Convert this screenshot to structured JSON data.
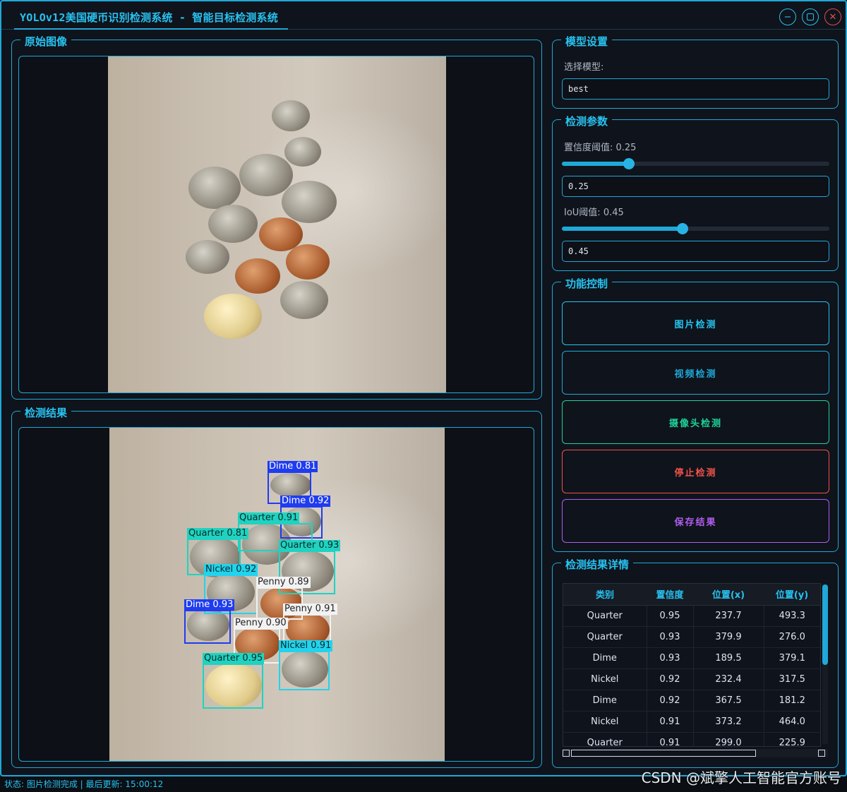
{
  "window": {
    "title": "YOLOv12美国硬币识别检测系统 - 智能目标检测系统",
    "min_glyph": "−",
    "max_glyph": "▢",
    "close_glyph": "✕"
  },
  "original_panel": {
    "title": "原始图像"
  },
  "result_panel": {
    "title": "检测结果",
    "detections": [
      {
        "label": "Dime 0.81",
        "color": "#1f3cf0",
        "text_color": "#ffffff"
      },
      {
        "label": "Dime 0.92",
        "color": "#1f3cf0",
        "text_color": "#ffffff"
      },
      {
        "label": "Quarter 0.91",
        "color": "#1fd3c0",
        "text_color": "#0a2a2a"
      },
      {
        "label": "Quarter 0.81",
        "color": "#1fd3c0",
        "text_color": "#0a2a2a"
      },
      {
        "label": "Quarter 0.93",
        "color": "#1fd3c0",
        "text_color": "#0a2a2a"
      },
      {
        "label": "Nickel 0.92",
        "color": "#22d3ee",
        "text_color": "#0a2a2a"
      },
      {
        "label": "Penny 0.89",
        "color": "#f2f2f2",
        "text_color": "#222222"
      },
      {
        "label": "Dime 0.93",
        "color": "#1f3cf0",
        "text_color": "#ffffff"
      },
      {
        "label": "Penny 0.91",
        "color": "#f2f2f2",
        "text_color": "#222222"
      },
      {
        "label": "Penny 0.90",
        "color": "#f2f2f2",
        "text_color": "#222222"
      },
      {
        "label": "Nickel 0.91",
        "color": "#22d3ee",
        "text_color": "#0a2a2a"
      },
      {
        "label": "Quarter 0.95",
        "color": "#1fd3c0",
        "text_color": "#0a2a2a"
      }
    ]
  },
  "model_settings": {
    "title": "模型设置",
    "select_label": "选择模型:",
    "selected_model": "best"
  },
  "detection_params": {
    "title": "检测参数",
    "confidence_label": "置信度阈值: 0.25",
    "confidence_value": "0.25",
    "confidence_fraction": 0.25,
    "iou_label": "IoU阈值: 0.45",
    "iou_value": "0.45",
    "iou_fraction": 0.45
  },
  "controls": {
    "title": "功能控制",
    "image_detect": "图片检测",
    "video_detect": "视频检测",
    "camera_detect": "摄像头检测",
    "stop_detect": "停止检测",
    "save_results": "保存结果",
    "colors": {
      "image": "#27c2f0",
      "video": "#1fa8d8",
      "camera": "#1fd39a",
      "stop": "#f0524a",
      "save": "#b05ef0"
    }
  },
  "results_table": {
    "title": "检测结果详情",
    "headers": [
      "类别",
      "置信度",
      "位置(x)",
      "位置(y)"
    ],
    "rows": [
      [
        "Quarter",
        "0.95",
        "237.7",
        "493.3"
      ],
      [
        "Quarter",
        "0.93",
        "379.9",
        "276.0"
      ],
      [
        "Dime",
        "0.93",
        "189.5",
        "379.1"
      ],
      [
        "Nickel",
        "0.92",
        "232.4",
        "317.5"
      ],
      [
        "Dime",
        "0.92",
        "367.5",
        "181.2"
      ],
      [
        "Nickel",
        "0.91",
        "373.2",
        "464.0"
      ],
      [
        "Quarter",
        "0.91",
        "299.0",
        "225.9"
      ]
    ]
  },
  "status": {
    "text": "状态: 图片检测完成 | 最后更新: 15:00:12"
  },
  "watermark": "CSDN @斌擎人工智能官方账号"
}
